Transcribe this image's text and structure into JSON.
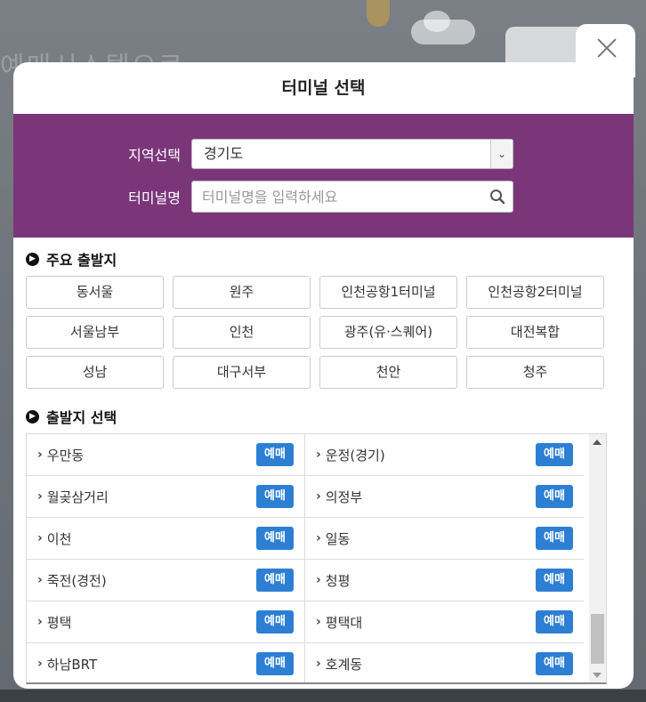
{
  "background": {
    "ghost_text": "예매시스템으로"
  },
  "modal": {
    "title": "터미널 선택",
    "close_label": "닫기"
  },
  "search": {
    "region_label": "지역선택",
    "region_value": "경기도",
    "terminal_label": "터미널명",
    "terminal_placeholder": "터미널명을 입력하세요"
  },
  "major": {
    "heading": "주요 출발지",
    "items": [
      "동서울",
      "원주",
      "인천공항1터미널",
      "인천공항2터미널",
      "서울남부",
      "인천",
      "광주(유·스퀘어)",
      "대전복합",
      "성남",
      "대구서부",
      "천안",
      "청주"
    ]
  },
  "departure": {
    "heading": "출발지 선택",
    "reserve_label": "예매",
    "rows": [
      {
        "left": "우만동",
        "right": "운정(경기)"
      },
      {
        "left": "월곶삼거리",
        "right": "의정부"
      },
      {
        "left": "이천",
        "right": "일동"
      },
      {
        "left": "죽전(경전)",
        "right": "청평"
      },
      {
        "left": "평택",
        "right": "평택대"
      },
      {
        "left": "하남BRT",
        "right": "호계동"
      }
    ]
  },
  "colors": {
    "brand_purple": "#7b3679",
    "reserve_blue": "#2d7fd4"
  }
}
